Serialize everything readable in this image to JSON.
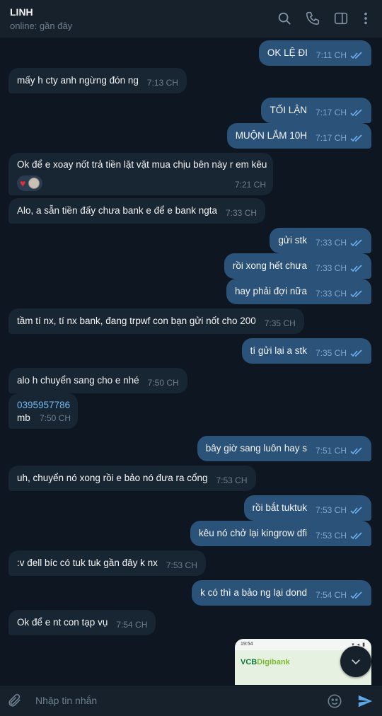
{
  "header": {
    "name": "LINH",
    "status": "online: gần đây"
  },
  "messages": [
    {
      "dir": "out",
      "text": "OK LỆ ĐI",
      "time": "7:11 CH"
    },
    {
      "dir": "in",
      "text": "mấy h cty anh ngừng đón ng",
      "time": "7:13 CH"
    },
    {
      "dir": "out",
      "text": "TỐI LẬN",
      "time": "7:17 CH"
    },
    {
      "dir": "out",
      "text": "MUỘN LẮM 10H",
      "time": "7:17 CH"
    },
    {
      "dir": "in",
      "text": "Ok để e xoay nốt trả tiền lặt vặt mua chịu bên này r em kêu",
      "time": "7:21 CH",
      "reactions": [
        "heart-icon",
        "avatar"
      ]
    },
    {
      "dir": "in",
      "text": "Alo, a sẵn tiền đấy chưa bank e để e bank ngta",
      "time": "7:33 CH"
    },
    {
      "dir": "out",
      "text": "gửi stk",
      "time": "7:33 CH"
    },
    {
      "dir": "out",
      "text": "rồi xong hết chưa",
      "time": "7:33 CH"
    },
    {
      "dir": "out",
      "text": "hay phải đợi nữa",
      "time": "7:33 CH"
    },
    {
      "dir": "in",
      "text": "tầm tí nx, tí nx bank, đang trpwf con bạn gửi nốt cho 200",
      "time": "7:35 CH"
    },
    {
      "dir": "out",
      "text": "tí gửi lại a stk",
      "time": "7:35 CH"
    },
    {
      "dir": "in",
      "text": "alo h chuyển sang cho e nhé",
      "time": "7:50 CH"
    },
    {
      "dir": "in",
      "text": "mb",
      "link": "0395957786",
      "time": "7:50 CH"
    },
    {
      "dir": "out",
      "text": "bây giờ sang luôn hay s",
      "time": "7:51 CH"
    },
    {
      "dir": "in",
      "text": "uh, chuyển nó xong rồi e bảo nó đưa ra cổng",
      "time": "7:53 CH"
    },
    {
      "dir": "out",
      "text": "rồi bắt tuktuk",
      "time": "7:53 CH"
    },
    {
      "dir": "out",
      "text": "kêu nó chở lại kingrow dfi",
      "time": "7:53 CH"
    },
    {
      "dir": "in",
      "text": ":v đell bíc có tuk tuk gần đây k nx",
      "time": "7:53 CH"
    },
    {
      "dir": "out",
      "text": "k có thì a bảo ng lại dond",
      "time": "7:54 CH"
    },
    {
      "dir": "in",
      "text": "Ok để e nt con tạp vụ",
      "time": "7:54 CH"
    }
  ],
  "image_message": {
    "status_time": "19:54",
    "status_icons": "▾ ◂ ▮",
    "logo_main": "VCB",
    "logo_sub": "Digibank"
  },
  "input": {
    "placeholder": "Nhập tin nhắn"
  },
  "colors": {
    "background": "#0e1621",
    "outgoing_bubble": "#2b5278",
    "incoming_bubble": "#182533",
    "accent": "#5fa8e8"
  }
}
